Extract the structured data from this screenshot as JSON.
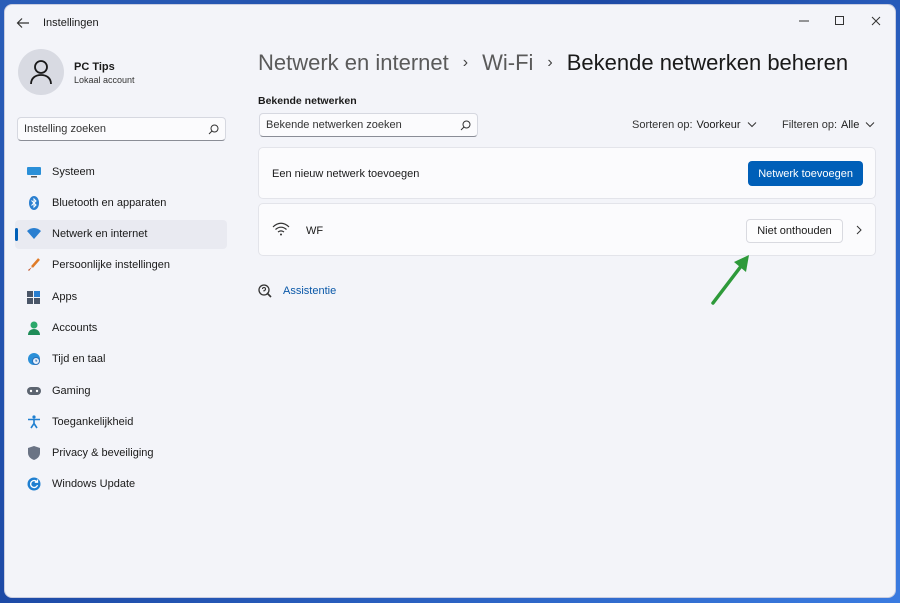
{
  "app": {
    "title": "Instellingen"
  },
  "user": {
    "name": "PC Tips",
    "account_type": "Lokaal account"
  },
  "sidebar": {
    "search_placeholder": "Instelling zoeken",
    "items": [
      {
        "label": "Systeem",
        "icon": "monitor-icon",
        "active": false
      },
      {
        "label": "Bluetooth en apparaten",
        "icon": "bluetooth-icon",
        "active": false
      },
      {
        "label": "Netwerk en internet",
        "icon": "network-icon",
        "active": true
      },
      {
        "label": "Persoonlijke instellingen",
        "icon": "brush-icon",
        "active": false
      },
      {
        "label": "Apps",
        "icon": "apps-icon",
        "active": false
      },
      {
        "label": "Accounts",
        "icon": "person-icon",
        "active": false
      },
      {
        "label": "Tijd en taal",
        "icon": "globe-clock-icon",
        "active": false
      },
      {
        "label": "Gaming",
        "icon": "gamepad-icon",
        "active": false
      },
      {
        "label": "Toegankelijkheid",
        "icon": "accessibility-icon",
        "active": false
      },
      {
        "label": "Privacy & beveiliging",
        "icon": "shield-icon",
        "active": false
      },
      {
        "label": "Windows Update",
        "icon": "update-icon",
        "active": false
      }
    ]
  },
  "breadcrumb": {
    "part1": "Netwerk en internet",
    "part2": "Wi-Fi",
    "current": "Bekende netwerken beheren"
  },
  "main": {
    "section_label": "Bekende netwerken",
    "search_placeholder": "Bekende netwerken zoeken",
    "sort_label": "Sorteren op:",
    "sort_value": "Voorkeur",
    "filter_label": "Filteren op:",
    "filter_value": "Alle",
    "add_network_text": "Een nieuw netwerk toevoegen",
    "add_network_button": "Netwerk toevoegen",
    "network_name": "WF",
    "forget_button": "Niet onthouden",
    "assist_link": "Assistentie"
  },
  "colors": {
    "accent": "#005fb8",
    "arrow": "#2e9a3a"
  }
}
